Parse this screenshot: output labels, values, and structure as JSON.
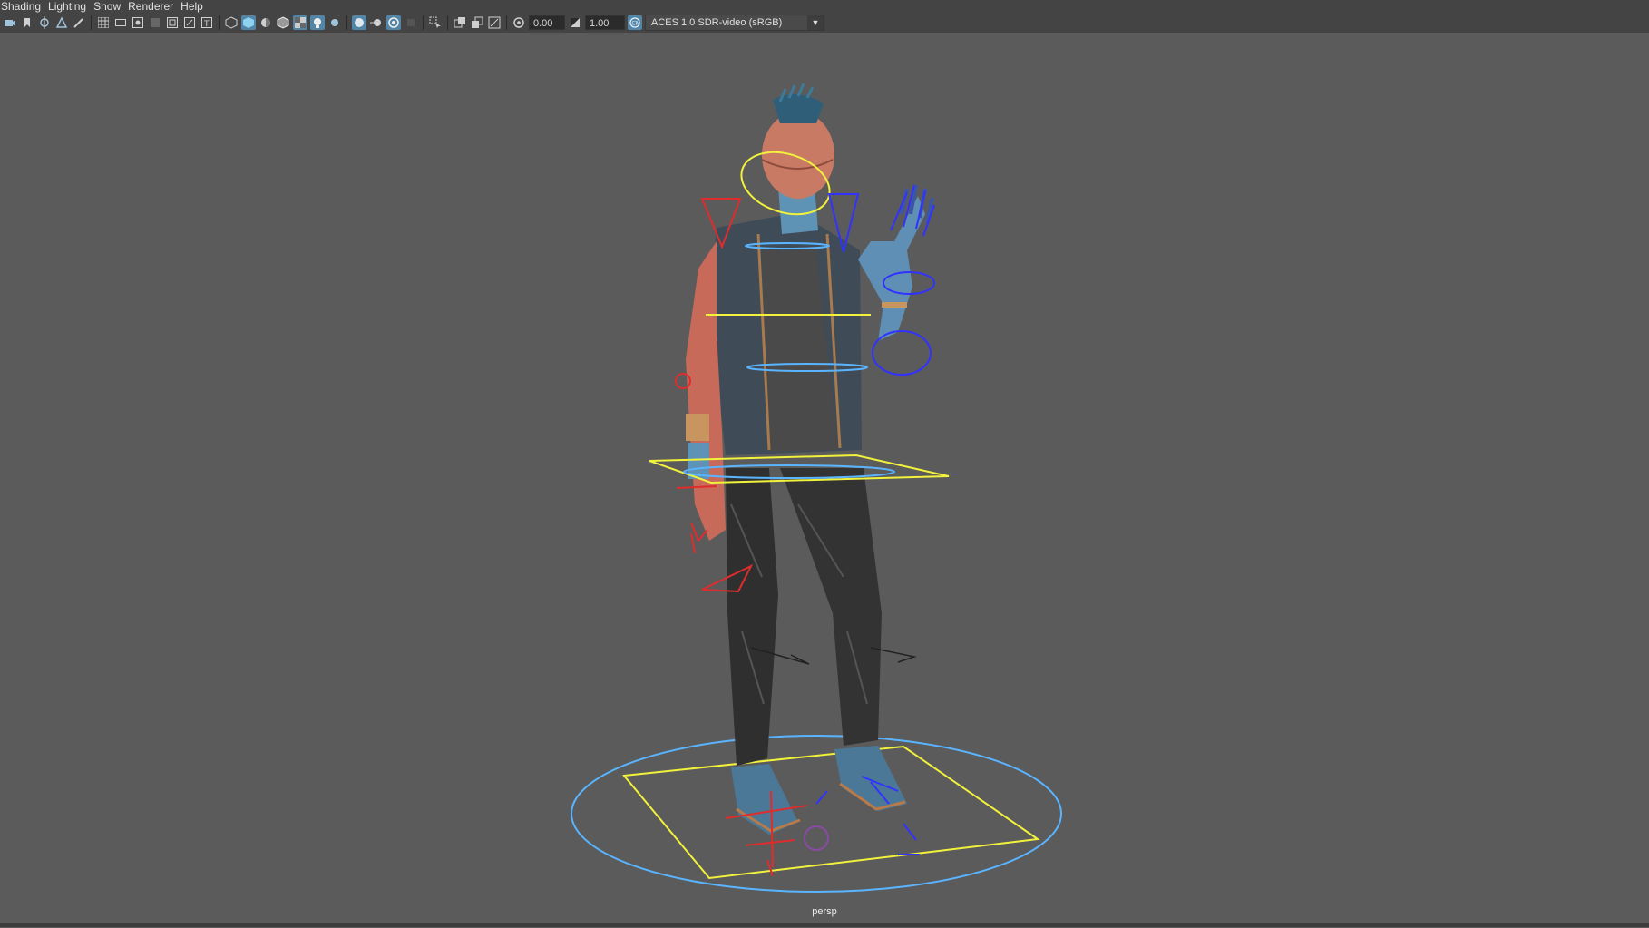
{
  "menubar": {
    "items": [
      "Shading",
      "Lighting",
      "Show",
      "Renderer",
      "Help"
    ]
  },
  "toolbar": {
    "exposure_value": "0.00",
    "gamma_value": "1.00",
    "color_space": "ACES 1.0 SDR-video (sRGB)",
    "icons": [
      "camera-icon",
      "bookmark-icon",
      "move-camera-icon",
      "select-icon",
      "paint-icon",
      "grid-icon",
      "film-gate-icon",
      "resolution-gate-icon",
      "safe-action-icon",
      "field-chart-icon",
      "safe-title-icon",
      "wireframe-icon",
      "smooth-shade-icon",
      "shade-lighting-icon",
      "wireframe-on-shaded-icon",
      "textured-icon",
      "use-lights-icon",
      "shadows-icon",
      "screen-space-ao-icon",
      "motion-blur-icon",
      "anti-aliasing-icon",
      "depth-of-field-icon",
      "isolate-select-icon",
      "xray-icon",
      "xray-joints-icon",
      "backface-icon",
      "exposure-icon",
      "gamma-icon",
      "color-management-icon"
    ]
  },
  "viewport": {
    "camera": "persp",
    "background": "#5b5b5b",
    "colors": {
      "root_ring": "#5ab4ff",
      "yellow_controls": "#f2f23c",
      "left_controls": "#e02c2c",
      "right_controls": "#3232ff"
    }
  }
}
